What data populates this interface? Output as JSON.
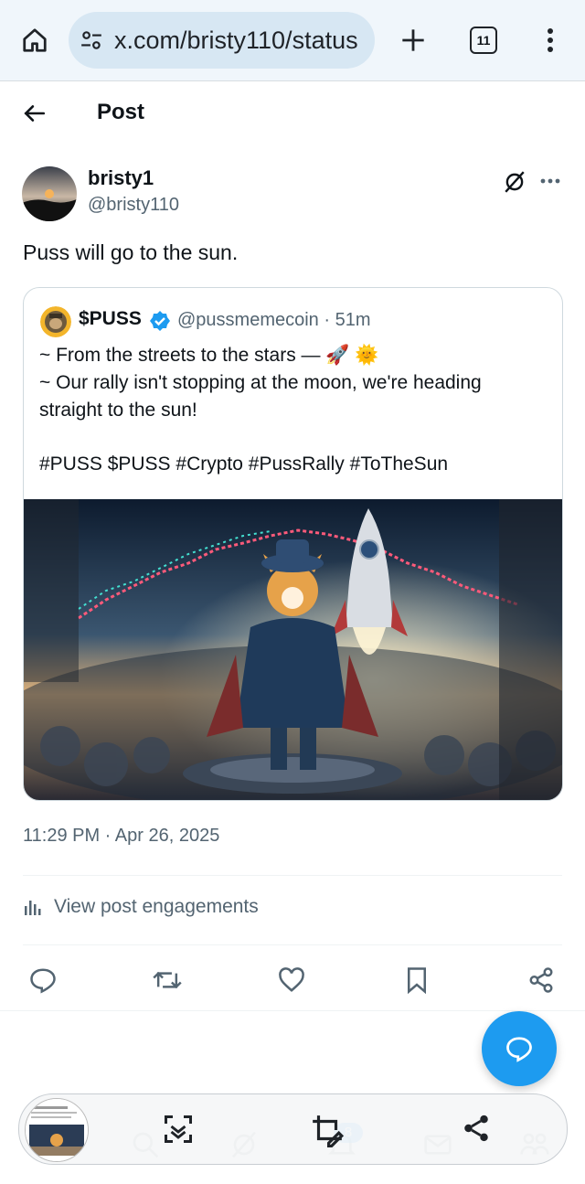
{
  "browser": {
    "url": "x.com/bristy110/status",
    "tab_count": "11"
  },
  "header": {
    "title": "Post"
  },
  "post": {
    "author_name": "bristy1",
    "author_handle": "@bristy110",
    "text": "Puss will go to the sun.",
    "timestamp": "11:29 PM · Apr 26, 2025",
    "engagements_label": "View post engagements"
  },
  "quote": {
    "name": "$PUSS",
    "handle_time": "@pussmemecoin · 51m",
    "lines": [
      "~ From the streets to the stars —",
      "~ Our rally isn't stopping at the moon, we're heading",
      "straight to the sun!",
      "#PUSS $PUSS #Crypto #PussRally #ToTheSun"
    ],
    "emojis": [
      "🚀",
      "🌞"
    ]
  },
  "bottom_nav": {
    "badge": "8"
  },
  "colors": {
    "accent": "#1d9bf0",
    "secondary_text": "#536471",
    "divider": "#eff3f4"
  }
}
